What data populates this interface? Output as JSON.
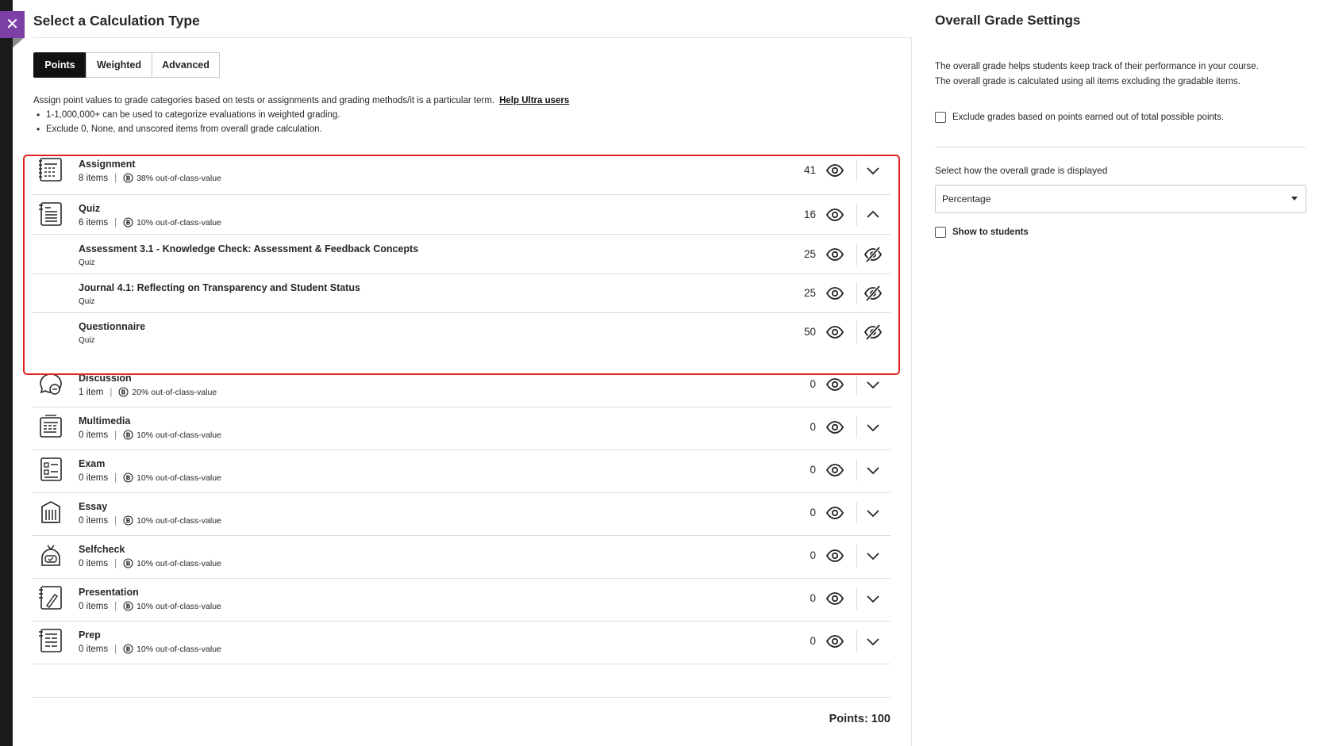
{
  "main": {
    "title": "Select a Calculation Type",
    "tabs": [
      {
        "label": "Points",
        "active": true
      },
      {
        "label": "Weighted",
        "active": false
      },
      {
        "label": "Advanced",
        "active": false
      }
    ],
    "intro_text": "Assign point values to grade categories based on tests or assignments and grading methods/it is a particular term.",
    "help_link": "Help Ultra users",
    "bullets": [
      "1-1,000,000+ can be used to categorize evaluations in weighted grading.",
      "Exclude 0, None, and unscored items from overall grade calculation."
    ],
    "categories": [
      {
        "name": "Assignment",
        "count": "8 items",
        "value": "38% out-of-class-value",
        "points": "41",
        "icon": "assignment-icon",
        "expanded": false
      },
      {
        "name": "Quiz",
        "count": "6 items",
        "value": "10% out-of-class-value",
        "points": "16",
        "icon": "quiz-icon",
        "expanded": true
      },
      {
        "name": "Discussion",
        "count": "1 item",
        "value": "20% out-of-class-value",
        "points": "0",
        "icon": "discussion-icon",
        "expanded": false
      },
      {
        "name": "Multimedia",
        "count": "0 items",
        "value": "10% out-of-class-value",
        "points": "0",
        "icon": "multimedia-icon",
        "expanded": false
      },
      {
        "name": "Exam",
        "count": "0 items",
        "value": "10% out-of-class-value",
        "points": "0",
        "icon": "exam-icon",
        "expanded": false
      },
      {
        "name": "Essay",
        "count": "0 items",
        "value": "10% out-of-class-value",
        "points": "0",
        "icon": "essay-icon",
        "expanded": false
      },
      {
        "name": "Selfcheck",
        "count": "0 items",
        "value": "10% out-of-class-value",
        "points": "0",
        "icon": "selfcheck-icon",
        "expanded": false
      },
      {
        "name": "Presentation",
        "count": "0 items",
        "value": "10% out-of-class-value",
        "points": "0",
        "icon": "presentation-icon",
        "expanded": false
      },
      {
        "name": "Prep",
        "count": "0 items",
        "value": "10% out-of-class-value",
        "points": "0",
        "icon": "prep-icon",
        "expanded": false
      }
    ],
    "quiz_items": [
      {
        "name": "Assessment 3.1 - Knowledge Check: Assessment & Feedback Concepts",
        "type": "Quiz",
        "points": "25"
      },
      {
        "name": "Journal 4.1: Reflecting on Transparency and Student Status",
        "type": "Quiz",
        "points": "25"
      },
      {
        "name": "Questionnaire",
        "type": "Quiz",
        "points": "50"
      }
    ],
    "total": "Points: 100"
  },
  "side": {
    "title": "Overall Grade Settings",
    "description_line1": "The overall grade helps students keep track of their performance in your course.",
    "description_line2": "The overall grade is calculated using all items excluding the gradable items.",
    "exclude_label": "Exclude grades based on points earned out of total possible points.",
    "display_label": "Select how the overall grade is displayed",
    "display_value": "Percentage",
    "show_students_label": "Show to students"
  },
  "colors": {
    "accent_purple": "#7b3fa6",
    "highlight_red": "#e02424",
    "active_tab": "#111111"
  }
}
